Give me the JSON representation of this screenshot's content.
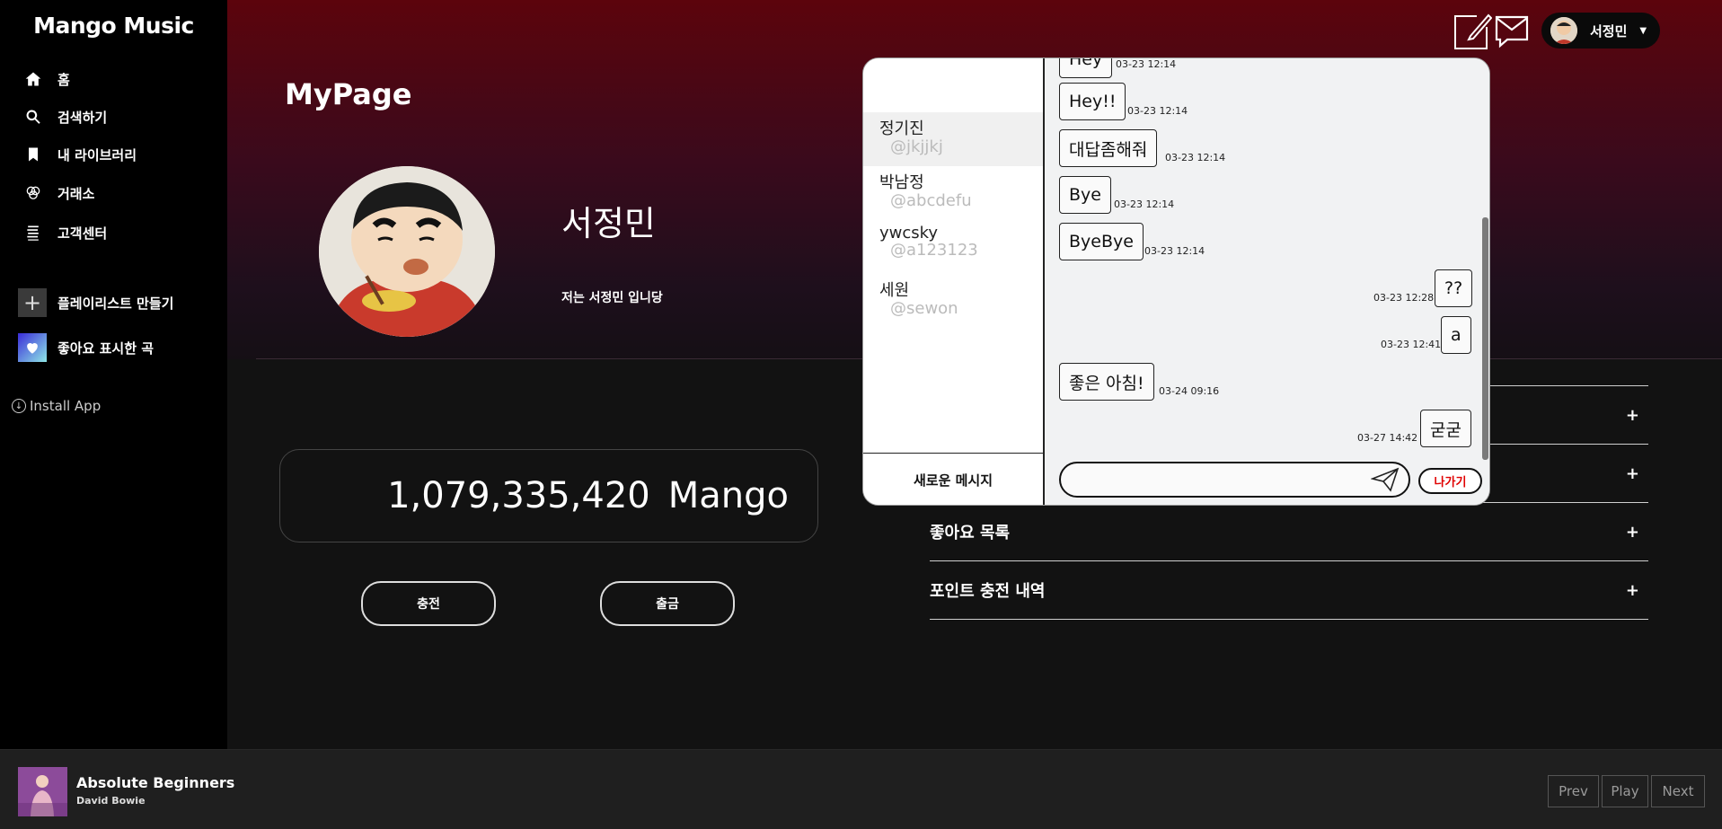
{
  "app": {
    "logo": "Mango Music"
  },
  "sidebar": {
    "items": [
      {
        "label": "홈",
        "icon": "home-icon"
      },
      {
        "label": "검색하기",
        "icon": "search-icon"
      },
      {
        "label": "내 라이브러리",
        "icon": "bookmark-icon"
      },
      {
        "label": "거래소",
        "icon": "exchange-icon"
      },
      {
        "label": "고객센터",
        "icon": "support-icon"
      }
    ],
    "create_playlist": "플레이리스트 만들기",
    "liked_songs": "좋아요 표시한 곡",
    "install": "Install App"
  },
  "header": {
    "user_name": "서정민"
  },
  "mypage": {
    "title": "MyPage",
    "name": "서정민",
    "bio": "저는 서정민 입니당",
    "points": "1,079,335,420",
    "points_unit": "Mango",
    "charge_label": "충전",
    "withdraw_label": "출금",
    "accordion": [
      {
        "label": "",
        "plus": "+"
      },
      {
        "label": "",
        "plus": "+"
      },
      {
        "label": "좋아요 목록",
        "plus": "+"
      },
      {
        "label": "포인트 충전 내역",
        "plus": "+"
      }
    ]
  },
  "chat": {
    "contacts": [
      {
        "name": "정기진",
        "id": "@jkjjkj"
      },
      {
        "name": "박남정",
        "id": "@abcdefu"
      },
      {
        "name": "ywcsky",
        "id": "@a123123"
      },
      {
        "name": "세원",
        "id": "@sewon"
      }
    ],
    "new_message": "새로운 메시지",
    "messages": [
      {
        "text": "Hey",
        "time": "03-23 12:14",
        "side": "left"
      },
      {
        "text": "Hey!!",
        "time": "03-23 12:14",
        "side": "left"
      },
      {
        "text": "대답좀해줘",
        "time": "03-23 12:14",
        "side": "left"
      },
      {
        "text": "Bye",
        "time": "03-23 12:14",
        "side": "left"
      },
      {
        "text": "ByeBye",
        "time": "03-23 12:14",
        "side": "left"
      },
      {
        "text": "??",
        "time": "03-23 12:28",
        "side": "right"
      },
      {
        "text": "a",
        "time": "03-23 12:41",
        "side": "right"
      },
      {
        "text": "좋은 아침!",
        "time": "03-24 09:16",
        "side": "left"
      },
      {
        "text": "굳굳",
        "time": "03-27 14:42",
        "side": "right"
      }
    ],
    "input_value": "",
    "exit_label": "나가기"
  },
  "player": {
    "title": "Absolute Beginners",
    "artist": "David Bowie",
    "prev": "Prev",
    "play": "Play",
    "next": "Next"
  }
}
